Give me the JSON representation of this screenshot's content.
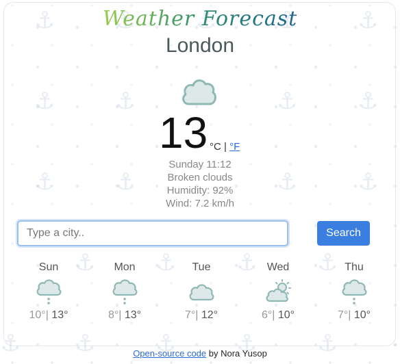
{
  "app": {
    "title": "Weather Forecast"
  },
  "current": {
    "city": "London",
    "temperature": "13",
    "unit_c": "°C",
    "unit_separator": "|",
    "unit_f": "°F",
    "day_time": "Sunday 11:12",
    "condition": "Broken clouds",
    "humidity": "Humidity: 92%",
    "wind": "Wind: 7.2 km/h",
    "icon": "cloud-icon"
  },
  "search": {
    "placeholder": "Type a city..",
    "button_label": "Search"
  },
  "forecast": [
    {
      "day": "Sun",
      "min": "10°",
      "separator": "|",
      "max": "13°",
      "icon": "rain-cloud-icon"
    },
    {
      "day": "Mon",
      "min": "8°",
      "separator": "|",
      "max": "13°",
      "icon": "rain-cloud-icon"
    },
    {
      "day": "Tue",
      "min": "7°",
      "separator": "|",
      "max": "12°",
      "icon": "cloud-icon"
    },
    {
      "day": "Wed",
      "min": "6°",
      "separator": "|",
      "max": "10°",
      "icon": "partly-sunny-icon"
    },
    {
      "day": "Thu",
      "min": "7°",
      "separator": "|",
      "max": "10°",
      "icon": "rain-cloud-icon"
    }
  ],
  "footer": {
    "link_text": "Open-source code",
    "author_text": "by Nora Yusop"
  },
  "colors": {
    "icon_stroke": "#8fb7b3",
    "icon_fill": "#dde9e8",
    "accent": "#3a7fe0",
    "link": "#2b6ad8"
  }
}
